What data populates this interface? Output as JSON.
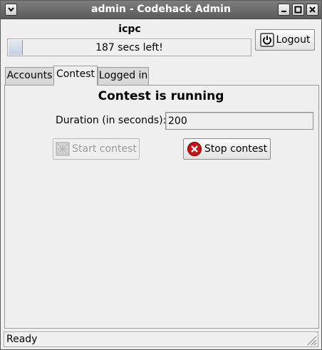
{
  "window": {
    "title": "admin - Codehack Admin",
    "controls": [
      "menu-icon",
      "minimize-icon",
      "maximize-icon",
      "close-icon"
    ]
  },
  "user": {
    "name": "icpc",
    "timer_text": "187 secs left!",
    "progress_fraction": 0.06,
    "logout_label": "Logout",
    "logout_icon": "power-icon"
  },
  "tabs": [
    {
      "label": "Accounts",
      "selected": false
    },
    {
      "label": "Contest",
      "selected": true
    },
    {
      "label": "Logged in",
      "selected": false
    }
  ],
  "contest": {
    "status": "Contest is running",
    "duration_label": "Duration (in seconds):",
    "duration_value": "200",
    "start_label": "Start contest",
    "start_enabled": false,
    "stop_label": "Stop contest",
    "stop_icon": "stop-icon",
    "stop_color": "#cc1111"
  },
  "statusbar": {
    "text": "Ready"
  }
}
